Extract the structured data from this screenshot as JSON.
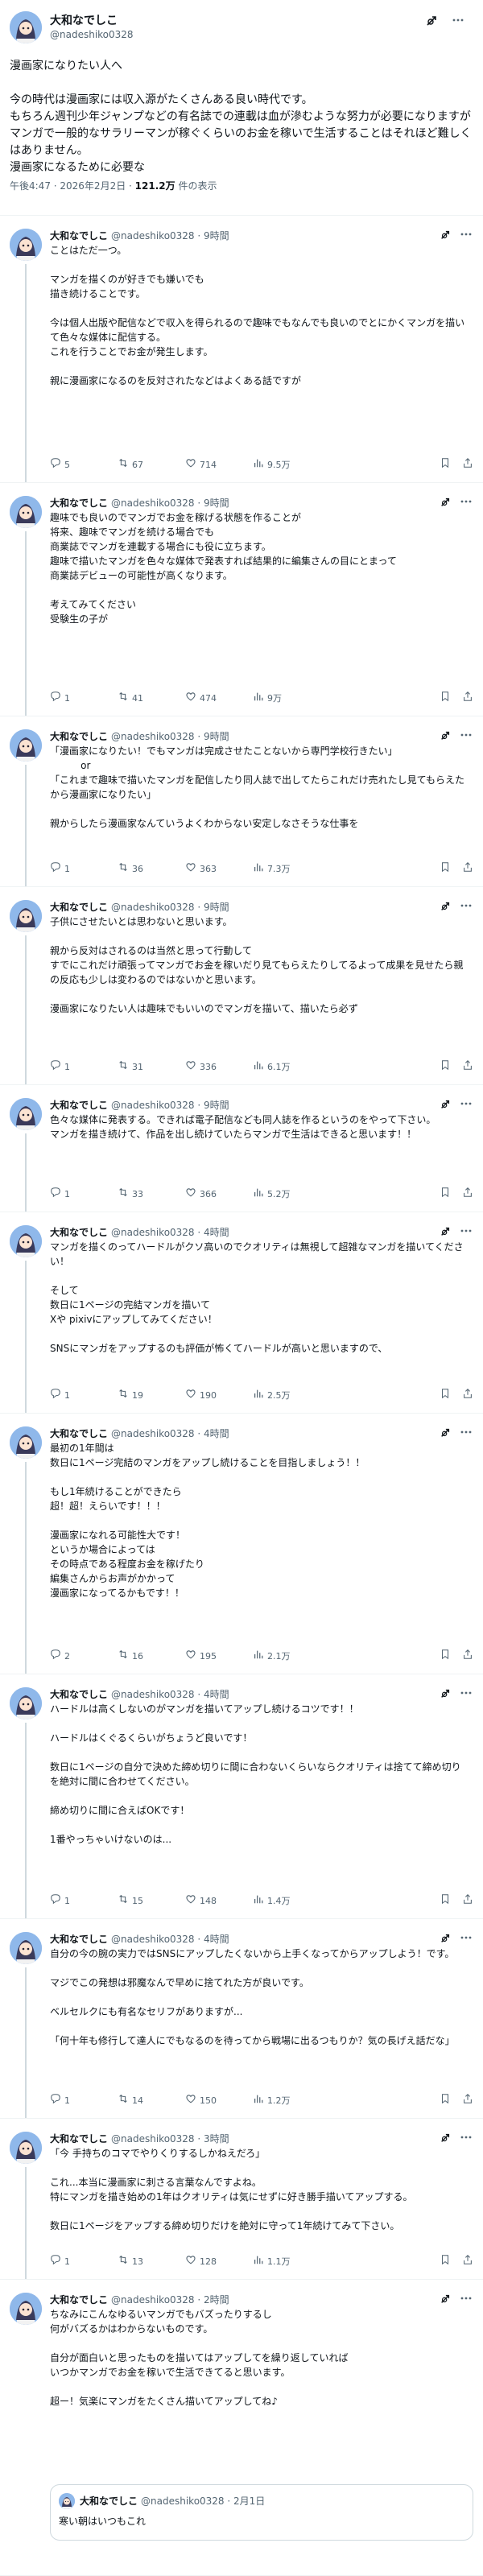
{
  "main_post": {
    "name": "大和なでしこ",
    "handle": "@nadeshiko0328",
    "lines": [
      "漫画家になりたい人へ",
      "",
      "今の時代は漫画家には収入源がたくさんある良い時代です。",
      "もちろん週刊少年ジャンプなどの有名誌での連載は血が滲むような努力が必要になりますが",
      "マンガで一般的なサラリーマンが稼ぐくらいのお金を稼いで生活することはそれほど難しくはありません。",
      "漫画家になるために必要な"
    ],
    "date": "午後4:47 · 2026年2月2日 · ",
    "views": "121.2万",
    "views_suffix": " 件の表示"
  },
  "replies": [
    {
      "name": "大和なでしこ",
      "handle": "@nadeshiko0328 · 9時間",
      "text": "ことはただ一つ。\n\nマンガを描くのが好きでも嫌いでも\n描き続けることです。\n\n今は個人出版や配信などで収入を得られるので趣味でもなんでも良いのでとにかくマンガを描いて色々な媒体に配信する。\nこれを行うことでお金が発生します。\n\n親に漫画家になるのを反対されたなどはよくある話ですが",
      "reply": "5",
      "retweet": "67",
      "like": "714",
      "views": "9.5万"
    },
    {
      "name": "大和なでしこ",
      "handle": "@nadeshiko0328 · 9時間",
      "text": "趣味でも良いのでマンガでお金を稼げる状態を作ることが\n将来、趣味でマンガを続ける場合でも\n商業誌でマンガを連載する場合にも役に立ちます。\n趣味で描いたマンガを色々な媒体で発表すれば結果的に編集さんの目にとまって\n商業誌デビューの可能性が高くなります。\n\n考えてみてください\n受験生の子が",
      "reply": "1",
      "retweet": "41",
      "like": "474",
      "views": "9万"
    },
    {
      "name": "大和なでしこ",
      "handle": "@nadeshiko0328 · 9時間",
      "text": "「漫画家になりたい！でもマンガは完成させたことないから専門学校行きたい」\n          or\n「これまで趣味で描いたマンガを配信したり同人誌で出してたらこれだけ売れたし見てもらえたから漫画家になりたい」\n\n親からしたら漫画家なんていうよくわからない安定しなさそうな仕事を",
      "reply": "1",
      "retweet": "36",
      "like": "363",
      "views": "7.3万"
    },
    {
      "name": "大和なでしこ",
      "handle": "@nadeshiko0328 · 9時間",
      "text": "子供にさせたいとは思わないと思います。\n\n親から反対はされるのは当然と思って行動して\nすでにこれだけ頑張ってマンガでお金を稼いだり見てもらえたりしてるよって成果を見せたら親の反応も少しは変わるのではないかと思います。\n\n漫画家になりたい人は趣味でもいいのでマンガを描いて、描いたら必ず",
      "reply": "1",
      "retweet": "31",
      "like": "336",
      "views": "6.1万"
    },
    {
      "name": "大和なでしこ",
      "handle": "@nadeshiko0328 · 9時間",
      "text": "色々な媒体に発表する。できれば電子配信なども同人誌を作るというのをやって下さい。\nマンガを描き続けて、作品を出し続けていたらマンガで生活はできると思います！！",
      "reply": "1",
      "retweet": "33",
      "like": "366",
      "views": "5.2万"
    },
    {
      "name": "大和なでしこ",
      "handle": "@nadeshiko0328 · 4時間",
      "text": "マンガを描くのってハードルがクソ高いのでクオリティは無視して超雑なマンガを描いてください！\n\nそして\n数日に1ページの完結マンガを描いて\nXや pixivにアップしてみてください！\n\nSNSにマンガをアップするのも評価が怖くてハードルが高いと思いますので、",
      "reply": "1",
      "retweet": "19",
      "like": "190",
      "views": "2.5万"
    },
    {
      "name": "大和なでしこ",
      "handle": "@nadeshiko0328 · 4時間",
      "text": "最初の1年間は\n数日に1ページ完結のマンガをアップし続けることを目指しましょう！！\n\nもし1年続けることができたら\n超！超！えらいです！！！\n\n漫画家になれる可能性大です！\nというか場合によっては\nその時点である程度お金を稼げたり\n編集さんからお声がかかって\n漫画家になってるかもです！！",
      "reply": "2",
      "retweet": "16",
      "like": "195",
      "views": "2.1万"
    },
    {
      "name": "大和なでしこ",
      "handle": "@nadeshiko0328 · 4時間",
      "text": "ハードルは高くしないのがマンガを描いてアップし続けるコツです！！\n\nハードルはくぐるくらいがちょうど良いです！\n\n数日に1ページの自分で決めた締め切りに間に合わないくらいならクオリティは捨てて締め切りを絶対に間に合わせてください。\n\n締め切りに間に合えばOKです！\n\n1番やっちゃいけないのは...",
      "reply": "1",
      "retweet": "15",
      "like": "148",
      "views": "1.4万"
    },
    {
      "name": "大和なでしこ",
      "handle": "@nadeshiko0328 · 4時間",
      "text": "自分の今の腕の実力ではSNSにアップしたくないから上手くなってからアップしよう！です。\n\nマジでこの発想は邪魔なんで早めに捨てれた方が良いです。\n\nベルセルクにも有名なセリフがありますが...\n\n「何十年も修行して達人にでもなるのを待ってから戦場に出るつもりか？気の長げえ話だな」",
      "reply": "1",
      "retweet": "14",
      "like": "150",
      "views": "1.2万"
    },
    {
      "name": "大和なでしこ",
      "handle": "@nadeshiko0328 · 3時間",
      "text": "「今 手持ちのコマでやりくりするしかねえだろ」\n\nこれ...本当に漫画家に刺さる言葉なんですよね。\n特にマンガを描き始めの1年はクオリティは気にせずに好き勝手描いてアップする。\n\n数日に1ページをアップする締め切りだけを絶対に守って1年続けてみて下さい。",
      "reply": "1",
      "retweet": "13",
      "like": "128",
      "views": "1.1万"
    },
    {
      "name": "大和なでしこ",
      "handle": "@nadeshiko0328 · 2時間",
      "text": "ちなみにこんなゆるいマンガでもバズったりするし\n何がバズるかはわからないものです。\n\n自分が面白いと思ったものを描いてはアップしてを繰り返していれば\nいつかマンガでお金を稼いで生活できてると思います。\n\n超ー！気楽にマンガをたくさん描いてアップしてね♪",
      "quote": {
        "name": "大和なでしこ",
        "handle": "@nadeshiko0328 · 2月1日",
        "text": "寒い朝はいつもこれ"
      }
    }
  ],
  "colors": {
    "text": "#0f1419",
    "muted": "#536471",
    "border": "#eff3f4",
    "thread": "#cfd9de",
    "avatar_bg": "#8fb8ea"
  },
  "icons": [
    "grok-icon",
    "more-icon",
    "reply-icon",
    "retweet-icon",
    "like-icon",
    "views-icon",
    "bookmark-icon",
    "share-icon"
  ]
}
